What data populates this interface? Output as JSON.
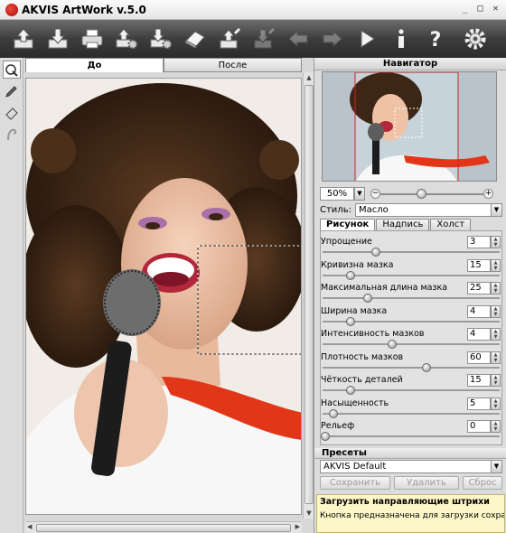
{
  "window": {
    "title": "AKVIS ArtWork v.5.0",
    "buttons": [
      "minimize",
      "maximize",
      "close"
    ]
  },
  "toolbar": {
    "buttons": [
      {
        "name": "open-image",
        "icon": "open-icon"
      },
      {
        "name": "save-image",
        "icon": "save-icon"
      },
      {
        "name": "print-image",
        "icon": "print-icon"
      },
      {
        "name": "open-settings",
        "icon": "upload-gear-icon"
      },
      {
        "name": "save-settings",
        "icon": "download-gear-icon"
      },
      {
        "name": "eraser",
        "icon": "eraser-icon"
      },
      {
        "name": "load-strokes",
        "icon": "upload-strokes-icon"
      },
      {
        "name": "save-strokes",
        "icon": "download-strokes-icon"
      },
      {
        "name": "undo",
        "icon": "arrow-left-icon",
        "disabled": true
      },
      {
        "name": "redo",
        "icon": "arrow-right-icon",
        "disabled": true
      },
      {
        "name": "run",
        "icon": "play-icon"
      },
      {
        "name": "about",
        "icon": "info-icon"
      },
      {
        "name": "help",
        "icon": "help-icon"
      },
      {
        "name": "preferences",
        "icon": "gear-icon"
      }
    ]
  },
  "left_tools": [
    "direction-brush-icon",
    "pencil-icon",
    "eraser-tool-icon",
    "hand-icon"
  ],
  "canvas": {
    "tabs": [
      {
        "label": "До",
        "active": true
      },
      {
        "label": "После",
        "active": false
      }
    ]
  },
  "navigator": {
    "title": "Навигатор",
    "zoom": "50%"
  },
  "style": {
    "label": "Стиль:",
    "value": "Масло"
  },
  "param_tabs": [
    {
      "label": "Рисунок",
      "active": true
    },
    {
      "label": "Надпись",
      "active": false
    },
    {
      "label": "Холст",
      "active": false
    }
  ],
  "params": [
    {
      "label": "Упрощение",
      "value": "3",
      "level": 0.3
    },
    {
      "label": "Кривизна мазка",
      "value": "15",
      "level": 0.15
    },
    {
      "label": "Максимальная длина мазка",
      "value": "25",
      "level": 0.25
    },
    {
      "label": "Ширина мазка",
      "value": "4",
      "level": 0.15
    },
    {
      "label": "Интенсивность мазков",
      "value": "4",
      "level": 0.4
    },
    {
      "label": "Плотность мазков",
      "value": "60",
      "level": 0.6
    },
    {
      "label": "Чёткость деталей",
      "value": "15",
      "level": 0.15
    },
    {
      "label": "Насыщенность",
      "value": "5",
      "level": 0.05
    },
    {
      "label": "Рельеф",
      "value": "0",
      "level": 0.0
    }
  ],
  "presets": {
    "title": "Пресеты",
    "selected": "AKVIS Default",
    "buttons": [
      "Сохранить",
      "Удалить",
      "Сброс"
    ]
  },
  "hint": {
    "title": "Загрузить направляющие штрихи",
    "text": "Кнопка предназначена для загрузки сохраненных ранее направляющих штрихов из"
  }
}
